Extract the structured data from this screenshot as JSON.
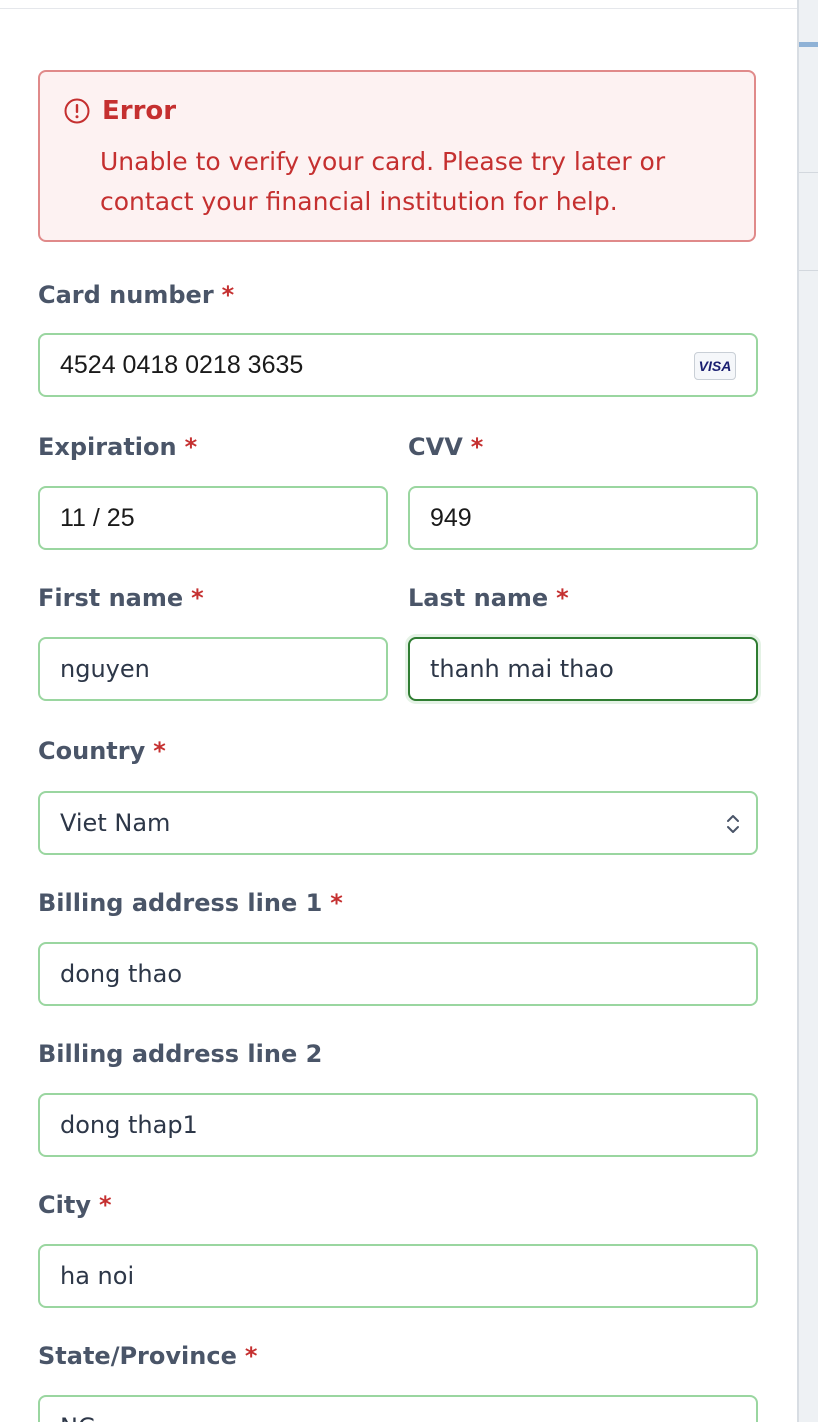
{
  "alert": {
    "title": "Error",
    "message_line1": "Unable to verify your card. Please try later or",
    "message_line2": "contact your financial institution for help.",
    "icon": "exclamation-circle-icon",
    "color": "#c53030"
  },
  "form": {
    "required_mark": "*",
    "card_number": {
      "label": "Card number",
      "value": "4524 0418 0218 3635",
      "brand": "VISA"
    },
    "expiration": {
      "label": "Expiration",
      "value": "11 / 25"
    },
    "cvv": {
      "label": "CVV",
      "value": "949"
    },
    "first_name": {
      "label": "First name",
      "value": "nguyen"
    },
    "last_name": {
      "label": "Last name",
      "value": "thanh mai thao"
    },
    "country": {
      "label": "Country",
      "value": "Viet Nam",
      "icon": "select-chevron-icon"
    },
    "billing_line1": {
      "label": "Billing address line 1",
      "value": "dong thao"
    },
    "billing_line2": {
      "label": "Billing address line 2",
      "value": "dong thap1"
    },
    "city": {
      "label": "City",
      "value": "ha noi"
    },
    "state": {
      "label": "State/Province",
      "value": "NC"
    }
  },
  "colors": {
    "valid_border": "#9ad6a0",
    "focus_border": "#2f7d32",
    "label": "#4a5568",
    "required": "#c53030"
  }
}
